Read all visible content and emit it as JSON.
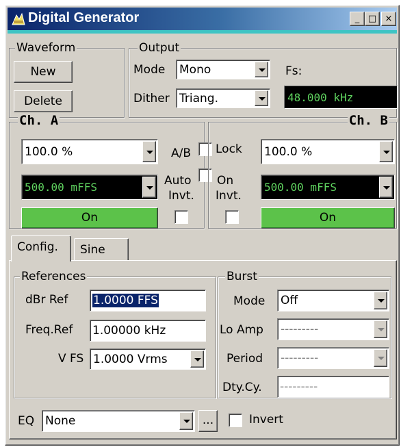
{
  "window": {
    "title": "Digital Generator",
    "controls": {
      "minimize": "_",
      "maximize": "□",
      "close": "×"
    }
  },
  "waveform": {
    "label": "Waveform",
    "new_label": "New",
    "delete_label": "Delete"
  },
  "output": {
    "label": "Output",
    "mode_label": "Mode",
    "mode_value": "Mono",
    "dither_label": "Dither",
    "dither_value": "Triang.",
    "fs_label": "Fs:",
    "fs_value": "48.000 kHz"
  },
  "center": {
    "ab_label": "A/B",
    "lock_label": "Lock",
    "auto_label": "Auto",
    "on_label": "On",
    "invt_label_a": "Invt.",
    "invt_label_b": "Invt."
  },
  "ch_a": {
    "label": "Ch. A",
    "percent": "100.0 %",
    "level": "500.00 mFFS",
    "on_label": "On"
  },
  "ch_b": {
    "label": "Ch. B",
    "percent": "100.0 %",
    "level": "500.00 mFFS",
    "on_label": "On"
  },
  "tabs": [
    {
      "label": "Config."
    },
    {
      "label": "Sine"
    }
  ],
  "references": {
    "label": "References",
    "dbr_label": "dBr Ref",
    "dbr_value": "1.0000 FFS",
    "freq_label": "Freq.Ref",
    "freq_value": "1.00000 kHz",
    "vfs_label": "V FS",
    "vfs_value": "1.0000 Vrms"
  },
  "burst": {
    "label": "Burst",
    "mode_label": "Mode",
    "mode_value": "Off",
    "lo_amp_label": "Lo Amp",
    "lo_amp_value": "---------",
    "period_label": "Period",
    "period_value": "---------",
    "dty_label": "Dty.Cy.",
    "dty_value": "---------"
  },
  "eq": {
    "label": "EQ",
    "value": "None",
    "browse_label": "...",
    "invert_label": "Invert"
  },
  "colors": {
    "on_green": "#5cc24a",
    "readout_green": "#5fd35f",
    "title_blue": "#0a246a"
  },
  "icons": {
    "app": "srs-logo-icon",
    "dropdown": "chevron-down-icon"
  }
}
